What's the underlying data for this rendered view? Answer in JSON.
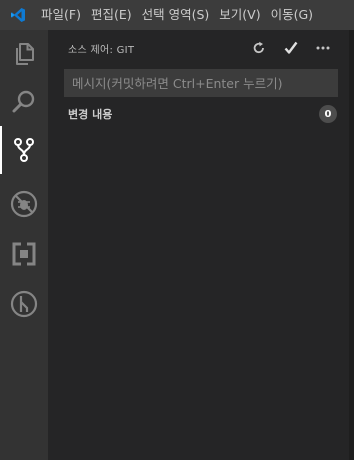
{
  "menubar": {
    "items": [
      "파일(F)",
      "편집(E)",
      "선택 영역(S)",
      "보기(V)",
      "이동(G)"
    ]
  },
  "activity_bar": {
    "items": [
      {
        "icon": "files-icon",
        "active": false
      },
      {
        "icon": "search-icon",
        "active": false
      },
      {
        "icon": "source-control-icon",
        "active": true
      },
      {
        "icon": "debug-icon",
        "active": false
      },
      {
        "icon": "extensions-icon",
        "active": false
      },
      {
        "icon": "git-graph-icon",
        "active": false
      }
    ]
  },
  "source_control": {
    "title": "소스 제어: GIT",
    "actions": [
      "refresh-icon",
      "commit-check-icon",
      "more-icon"
    ],
    "message_placeholder": "메시지(커밋하려면 Ctrl+Enter 누르기)",
    "changes_label": "변경 내용",
    "changes_count": "0"
  },
  "colors": {
    "titlebar": "#3c3c3c",
    "activitybar": "#333333",
    "sidebar": "#252526",
    "brand_blue": "#0e7ad3"
  }
}
